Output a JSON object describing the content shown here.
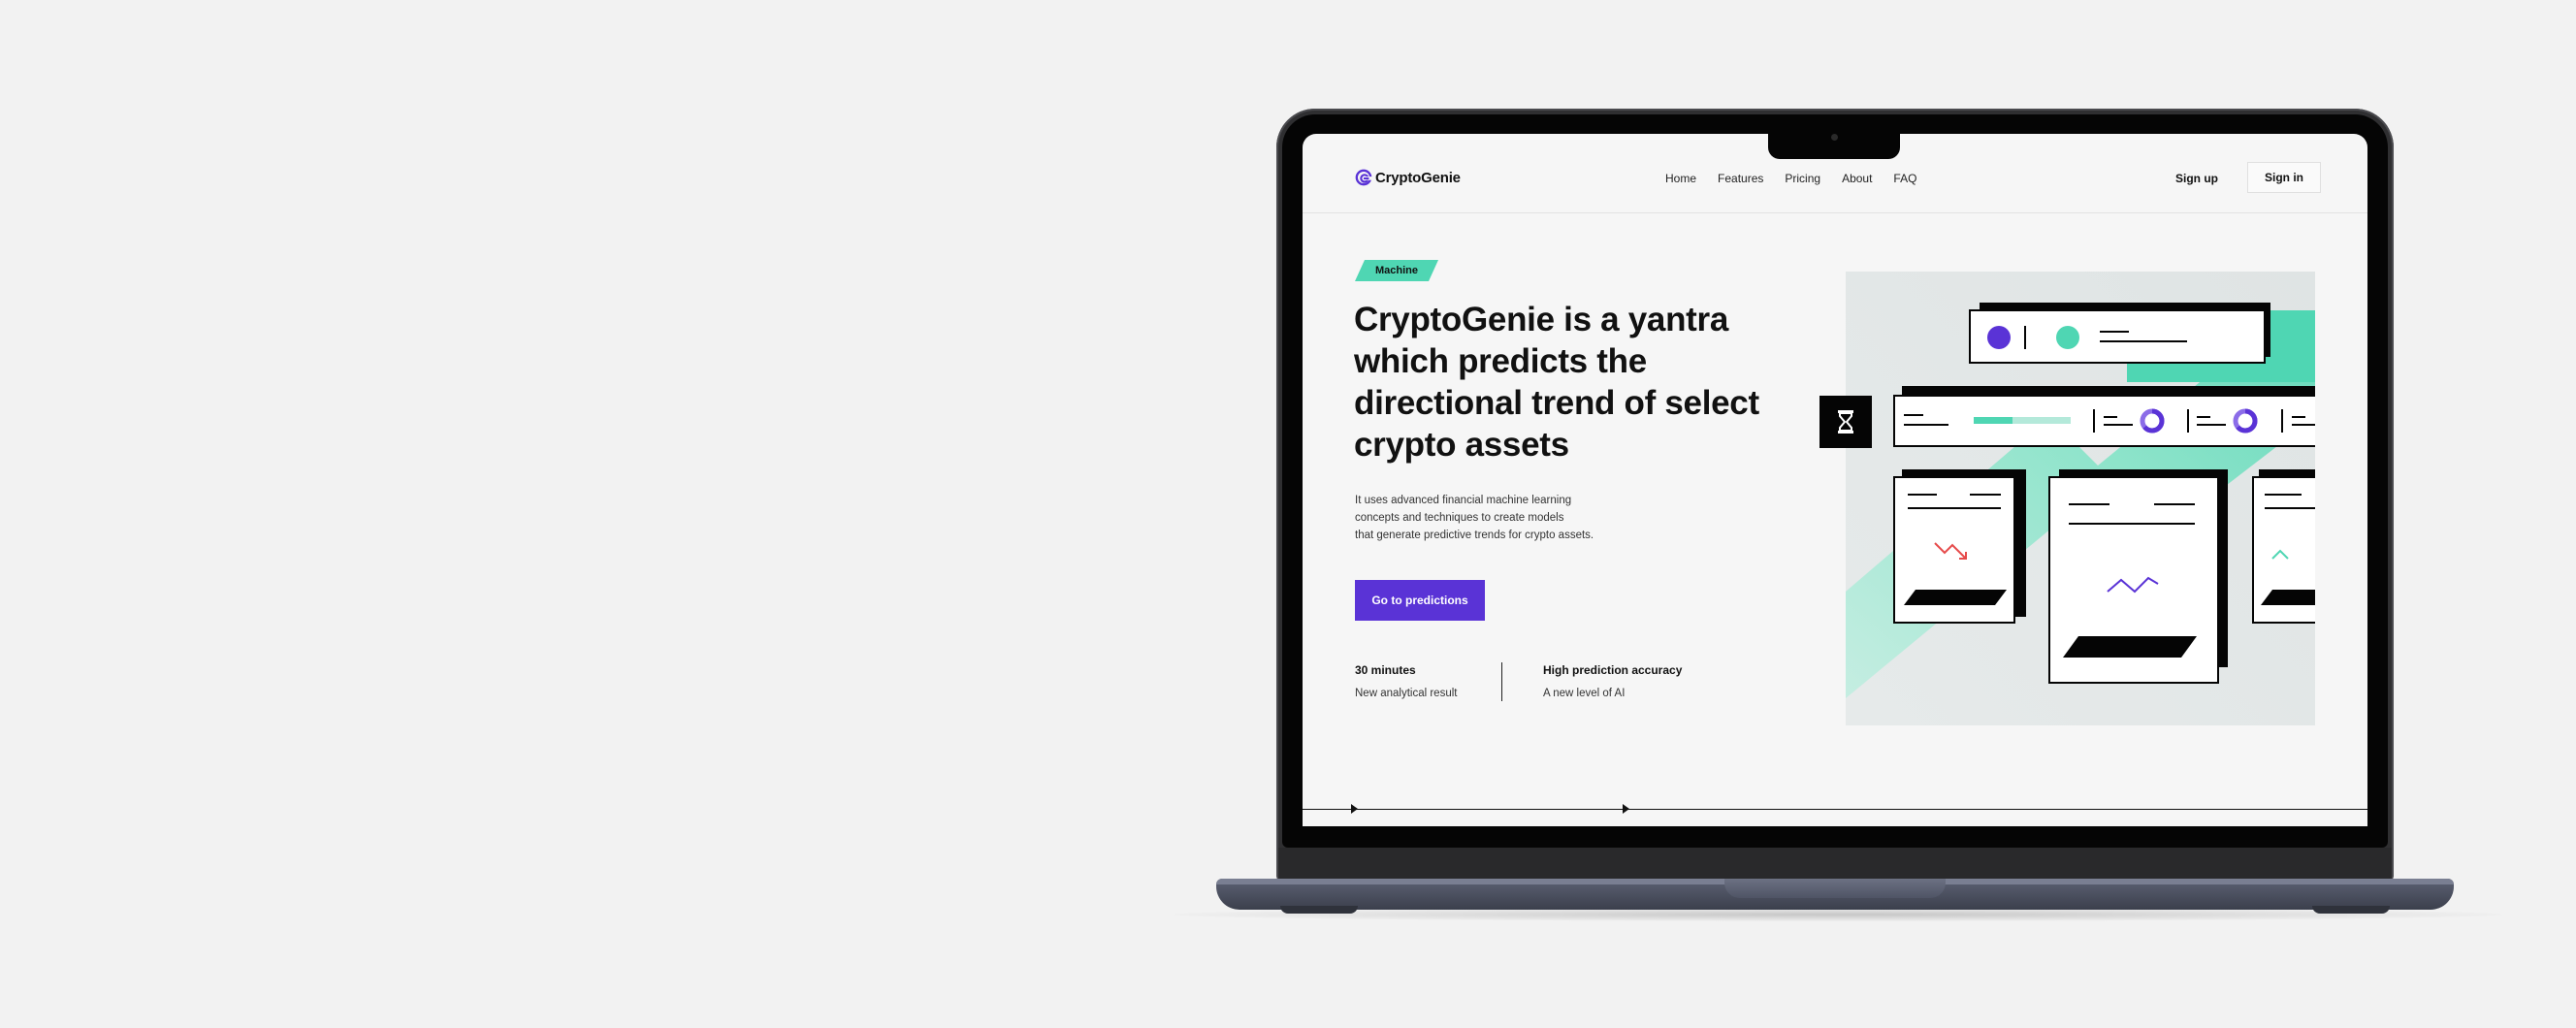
{
  "brand": {
    "name": "CryptoGenie",
    "accent": "#5a33d6",
    "teal": "#4fd6b3"
  },
  "nav": {
    "items": [
      "Home",
      "Features",
      "Pricing",
      "About",
      "FAQ"
    ],
    "signup": "Sign up",
    "signin": "Sign in"
  },
  "hero": {
    "badge": "Machine",
    "headline_lines": [
      "CryptoGenie is a yantra",
      "which predicts the",
      "directional trend of select",
      "crypto assets"
    ],
    "desc_lines": [
      "It uses advanced financial machine learning",
      "concepts and techniques to create models",
      "that generate predictive trends for crypto assets."
    ],
    "cta": "Go to predictions",
    "stats": [
      {
        "title": "30 minutes",
        "subtitle": "New analytical result"
      },
      {
        "title": "High prediction accuracy",
        "subtitle": "A new level of AI"
      }
    ]
  },
  "icons": {
    "logo": "cryptogenie-logo-icon",
    "hourglass": "hourglass-icon",
    "play": "play-marker-icon"
  }
}
